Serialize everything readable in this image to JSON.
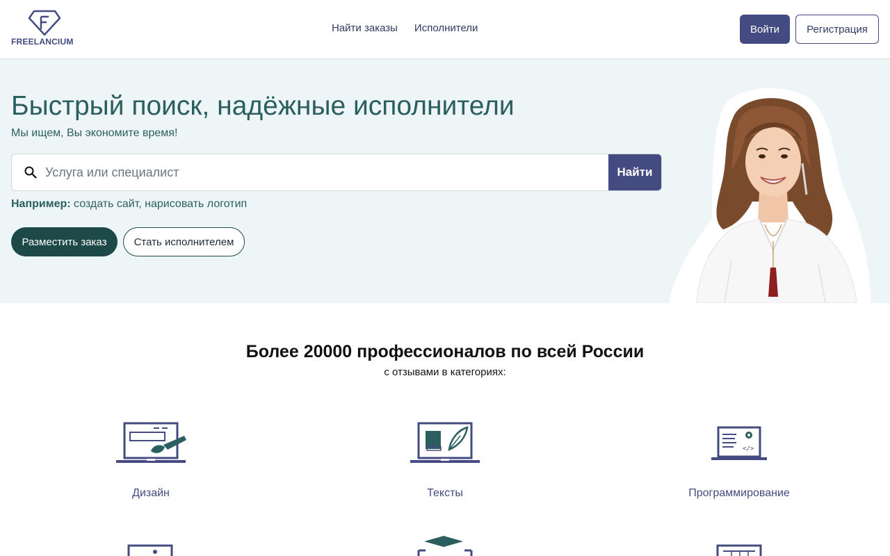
{
  "header": {
    "logo_text": "FREELANCIUM",
    "nav": [
      {
        "label": "Найти заказы"
      },
      {
        "label": "Исполнители"
      }
    ],
    "login_label": "Войти",
    "register_label": "Регистрация"
  },
  "hero": {
    "title": "Быстрый поиск, надёжные исполнители",
    "subtitle": "Мы ищем, Вы экономите время!",
    "search_placeholder": "Услуга или специалист",
    "search_button": "Найти",
    "example_label": "Например:",
    "example_1": "создать сайт",
    "example_separator": ", ",
    "example_2": "нарисовать логотип",
    "order_button": "Разместить заказ",
    "become_button": "Стать исполнителем"
  },
  "stats": {
    "title": "Более 20000 профессионалов по всей России",
    "subtitle": "с отзывами в категориях:"
  },
  "categories": [
    {
      "label": "Дизайн",
      "icon": "design-icon"
    },
    {
      "label": "Тексты",
      "icon": "texts-icon"
    },
    {
      "label": "Программирование",
      "icon": "programming-icon"
    }
  ],
  "colors": {
    "brand": "#434b80",
    "accent_dark": "#1d4a48",
    "hero_text": "#2b5e5e",
    "hero_bg": "#eef5f7"
  }
}
